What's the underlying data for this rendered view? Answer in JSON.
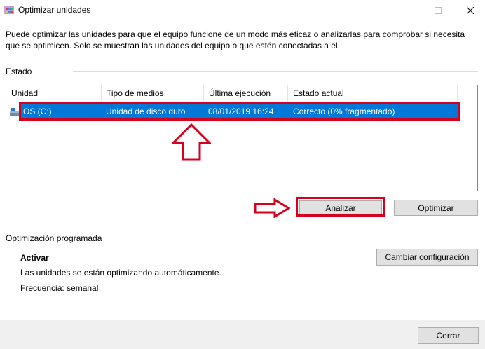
{
  "window": {
    "title": "Optimizar unidades",
    "controls": {
      "minimize": "—",
      "maximize": "☐",
      "close": "✕"
    }
  },
  "description": "Puede optimizar las unidades para que el equipo funcione de un modo más eficaz o analizarlas para comprobar si necesita que se optimicen. Solo se muestran las unidades del equipo o que estén conectadas a él.",
  "status": {
    "label": "Estado",
    "columns": [
      "Unidad",
      "Tipo de medios",
      "Última ejecución",
      "Estado actual"
    ],
    "rows": [
      {
        "icon": "drive-icon",
        "unit": "OS (C:)",
        "media_type": "Unidad de disco duro",
        "last_run": "08/01/2019 16:24",
        "current_status": "Correcto (0% fragmentado)",
        "selected": true
      }
    ]
  },
  "actions": {
    "analyze": "Analizar",
    "optimize": "Optimizar"
  },
  "scheduled": {
    "label": "Optimización programada",
    "state": "Activar",
    "info": "Las unidades se están optimizando automáticamente.",
    "frequency": "Frecuencia: semanal",
    "change_button": "Cambiar configuración"
  },
  "footer": {
    "close_button": "Cerrar"
  },
  "annotations": {
    "color": "#d6001c",
    "arrow_up": "arrow-up-annotation",
    "arrow_right": "arrow-right-annotation"
  }
}
